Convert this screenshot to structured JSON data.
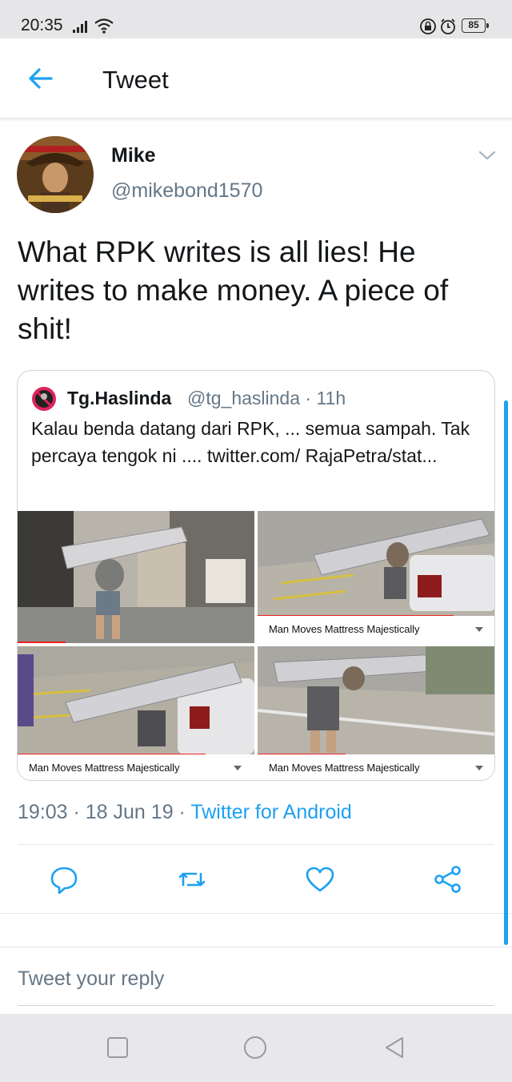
{
  "status_bar": {
    "time": "20:35",
    "battery": "85"
  },
  "header": {
    "title": "Tweet"
  },
  "tweet": {
    "author_name": "Mike",
    "author_handle": "@mikebond1570",
    "text": "What RPK writes is all lies! He writes to make money. A piece of shit!",
    "timestamp": "19:03 · 18 Jun 19 · ",
    "via": "Twitter for Android"
  },
  "quote": {
    "name": "Tg.Haslinda",
    "meta": "@tg_haslinda · 11h",
    "text": "Kalau benda datang dari RPK, ... semua sampah. Tak percaya tengok ni .... twitter.com/ RajaPetra/stat...",
    "media_captions": [
      "Man Moves Mattress Majestically",
      "Man Moves Mattress Majestically",
      "Man Moves Mattress Majestically"
    ]
  },
  "reply": {
    "placeholder": "Tweet your reply"
  },
  "icons": {
    "back": "arrow-left-icon",
    "more": "chevron-down-icon",
    "reply": "reply-icon",
    "retweet": "retweet-icon",
    "like": "heart-icon",
    "share": "share-icon"
  },
  "colors": {
    "accent": "#1da1f2",
    "secondary_text": "#657786",
    "divider": "#e1e8ed"
  }
}
